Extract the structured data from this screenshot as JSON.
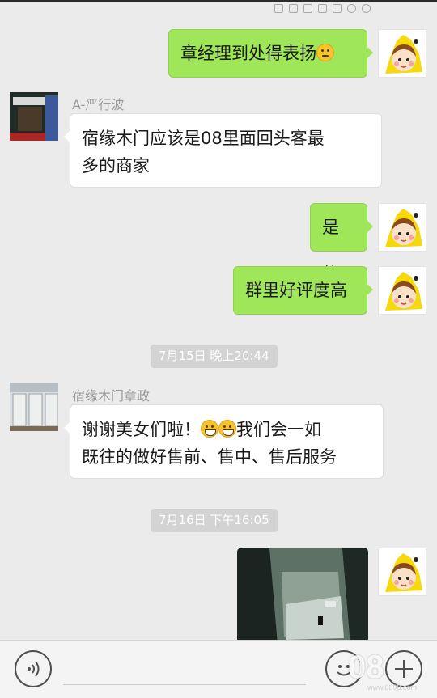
{
  "messages": [
    {
      "id": "m1",
      "direction": "outgoing",
      "text": "章经理到处得表扬",
      "emoji": "thinking-face-emoji"
    },
    {
      "id": "m2",
      "direction": "incoming",
      "sender": "A-严行波",
      "line1": "宿缘木门应该是08里面回头客最",
      "line2": "多的商家"
    },
    {
      "id": "m3",
      "direction": "outgoing",
      "text": "是的"
    },
    {
      "id": "m4",
      "direction": "outgoing",
      "text": "群里好评度高"
    },
    {
      "id": "t1",
      "type": "timestamp",
      "text": "7月15日 晚上20:44"
    },
    {
      "id": "m5",
      "direction": "incoming",
      "sender": "宿缘木门章政",
      "line1_a": "谢谢美女们啦！",
      "line1_b": "我们会一如",
      "line2": "既往的做好售前、售中、售后服务",
      "emoji": "grinning-face-emoji"
    },
    {
      "id": "t2",
      "type": "timestamp",
      "text": "7月16日 下午16:05"
    },
    {
      "id": "m6",
      "direction": "outgoing",
      "type": "image"
    }
  ],
  "watermark": {
    "text": "08",
    "sub": "www.0898.com"
  },
  "colors": {
    "outgoing_bubble": "#9fe658",
    "incoming_bubble": "#ffffff",
    "background": "#ebebeb",
    "timestamp_pill": "#d3d3d3"
  },
  "icons": {
    "voice": "voice-input-icon",
    "emoji": "emoji-icon",
    "more": "plus-icon"
  }
}
